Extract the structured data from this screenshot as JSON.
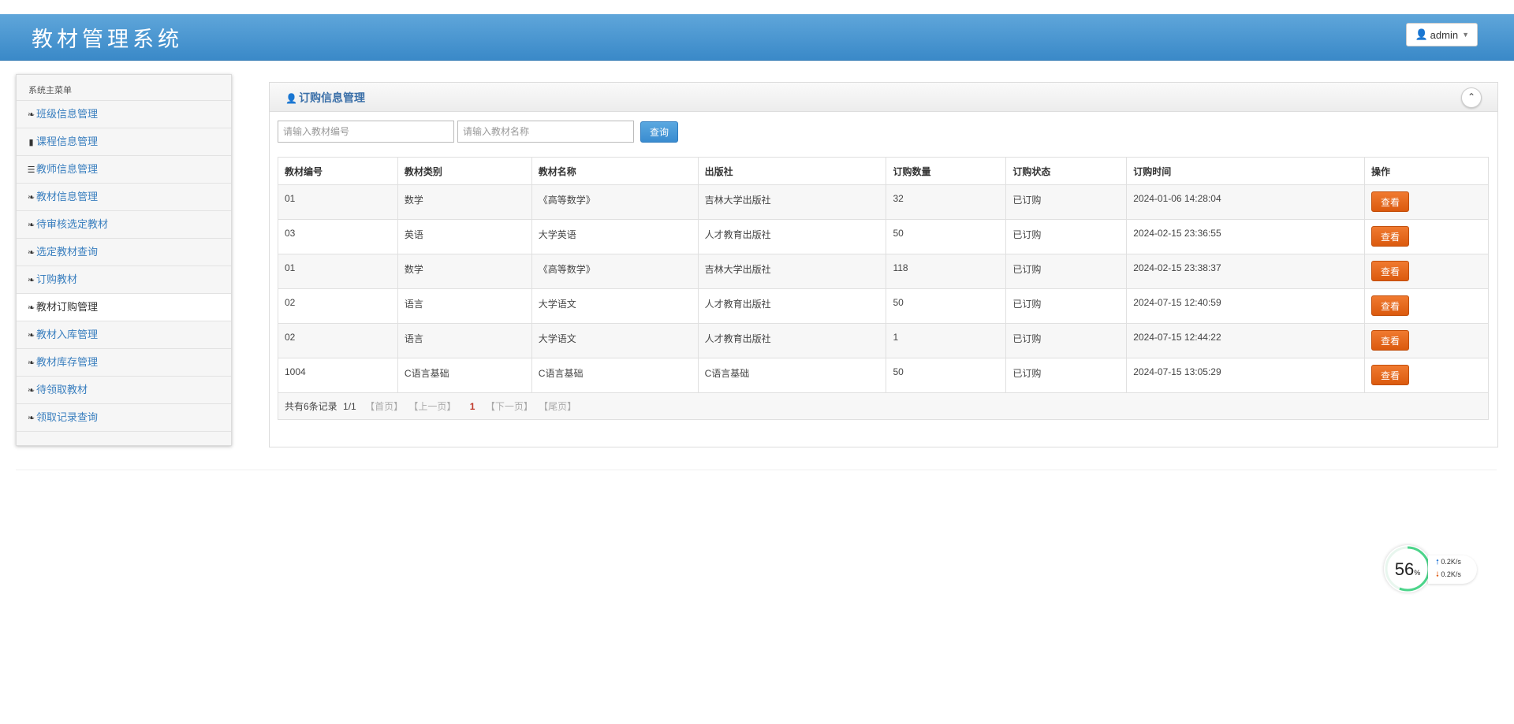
{
  "header": {
    "title": "教材管理系统",
    "user": "admin"
  },
  "sidebar": {
    "title": "系统主菜单",
    "items": [
      {
        "label": "班级信息管理",
        "icon": "leaf-icon"
      },
      {
        "label": "课程信息管理",
        "icon": "bookmark-icon"
      },
      {
        "label": "教师信息管理",
        "icon": "list-icon"
      },
      {
        "label": "教材信息管理",
        "icon": "leaf-icon"
      },
      {
        "label": "待审核选定教材",
        "icon": "leaf-icon"
      },
      {
        "label": "选定教材查询",
        "icon": "leaf-icon"
      },
      {
        "label": "订购教材",
        "icon": "leaf-icon"
      },
      {
        "label": "教材订购管理",
        "icon": "leaf-icon",
        "active": true
      },
      {
        "label": "教材入库管理",
        "icon": "leaf-icon"
      },
      {
        "label": "教材库存管理",
        "icon": "leaf-icon"
      },
      {
        "label": "待领取教材",
        "icon": "leaf-icon"
      },
      {
        "label": "领取记录查询",
        "icon": "leaf-icon"
      }
    ]
  },
  "panel": {
    "title": "订购信息管理",
    "search": {
      "code_placeholder": "请输入教材编号",
      "name_placeholder": "请输入教材名称",
      "button": "查询"
    },
    "table": {
      "headers": [
        "教材编号",
        "教材类别",
        "教材名称",
        "出版社",
        "订购数量",
        "订购状态",
        "订购时间",
        "操作"
      ],
      "rows": [
        [
          "01",
          "数学",
          "《高等数学》",
          "吉林大学出版社",
          "32",
          "已订购",
          "2024-01-06 14:28:04"
        ],
        [
          "03",
          "英语",
          "大学英语",
          "人才教育出版社",
          "50",
          "已订购",
          "2024-02-15 23:36:55"
        ],
        [
          "01",
          "数学",
          "《高等数学》",
          "吉林大学出版社",
          "118",
          "已订购",
          "2024-02-15 23:38:37"
        ],
        [
          "02",
          "语言",
          "大学语文",
          "人才教育出版社",
          "50",
          "已订购",
          "2024-07-15 12:40:59"
        ],
        [
          "02",
          "语言",
          "大学语文",
          "人才教育出版社",
          "1",
          "已订购",
          "2024-07-15 12:44:22"
        ],
        [
          "1004",
          "C语言基础",
          "C语言基础",
          "C语言基础",
          "50",
          "已订购",
          "2024-07-15 13:05:29"
        ]
      ],
      "action_label": "查看"
    },
    "pager": {
      "summary": "共有6条记录",
      "page_info": "1/1",
      "first": "【首页】",
      "prev": "【上一页】",
      "current": "1",
      "next": "【下一页】",
      "last": "【尾页】"
    }
  },
  "net_widget": {
    "percent": "56",
    "unit": "%",
    "up": "0.2K/s",
    "down": "0.2K/s"
  },
  "colors": {
    "header": "#3a89c8",
    "link": "#3a7fbf",
    "action": "#db5a0e"
  }
}
